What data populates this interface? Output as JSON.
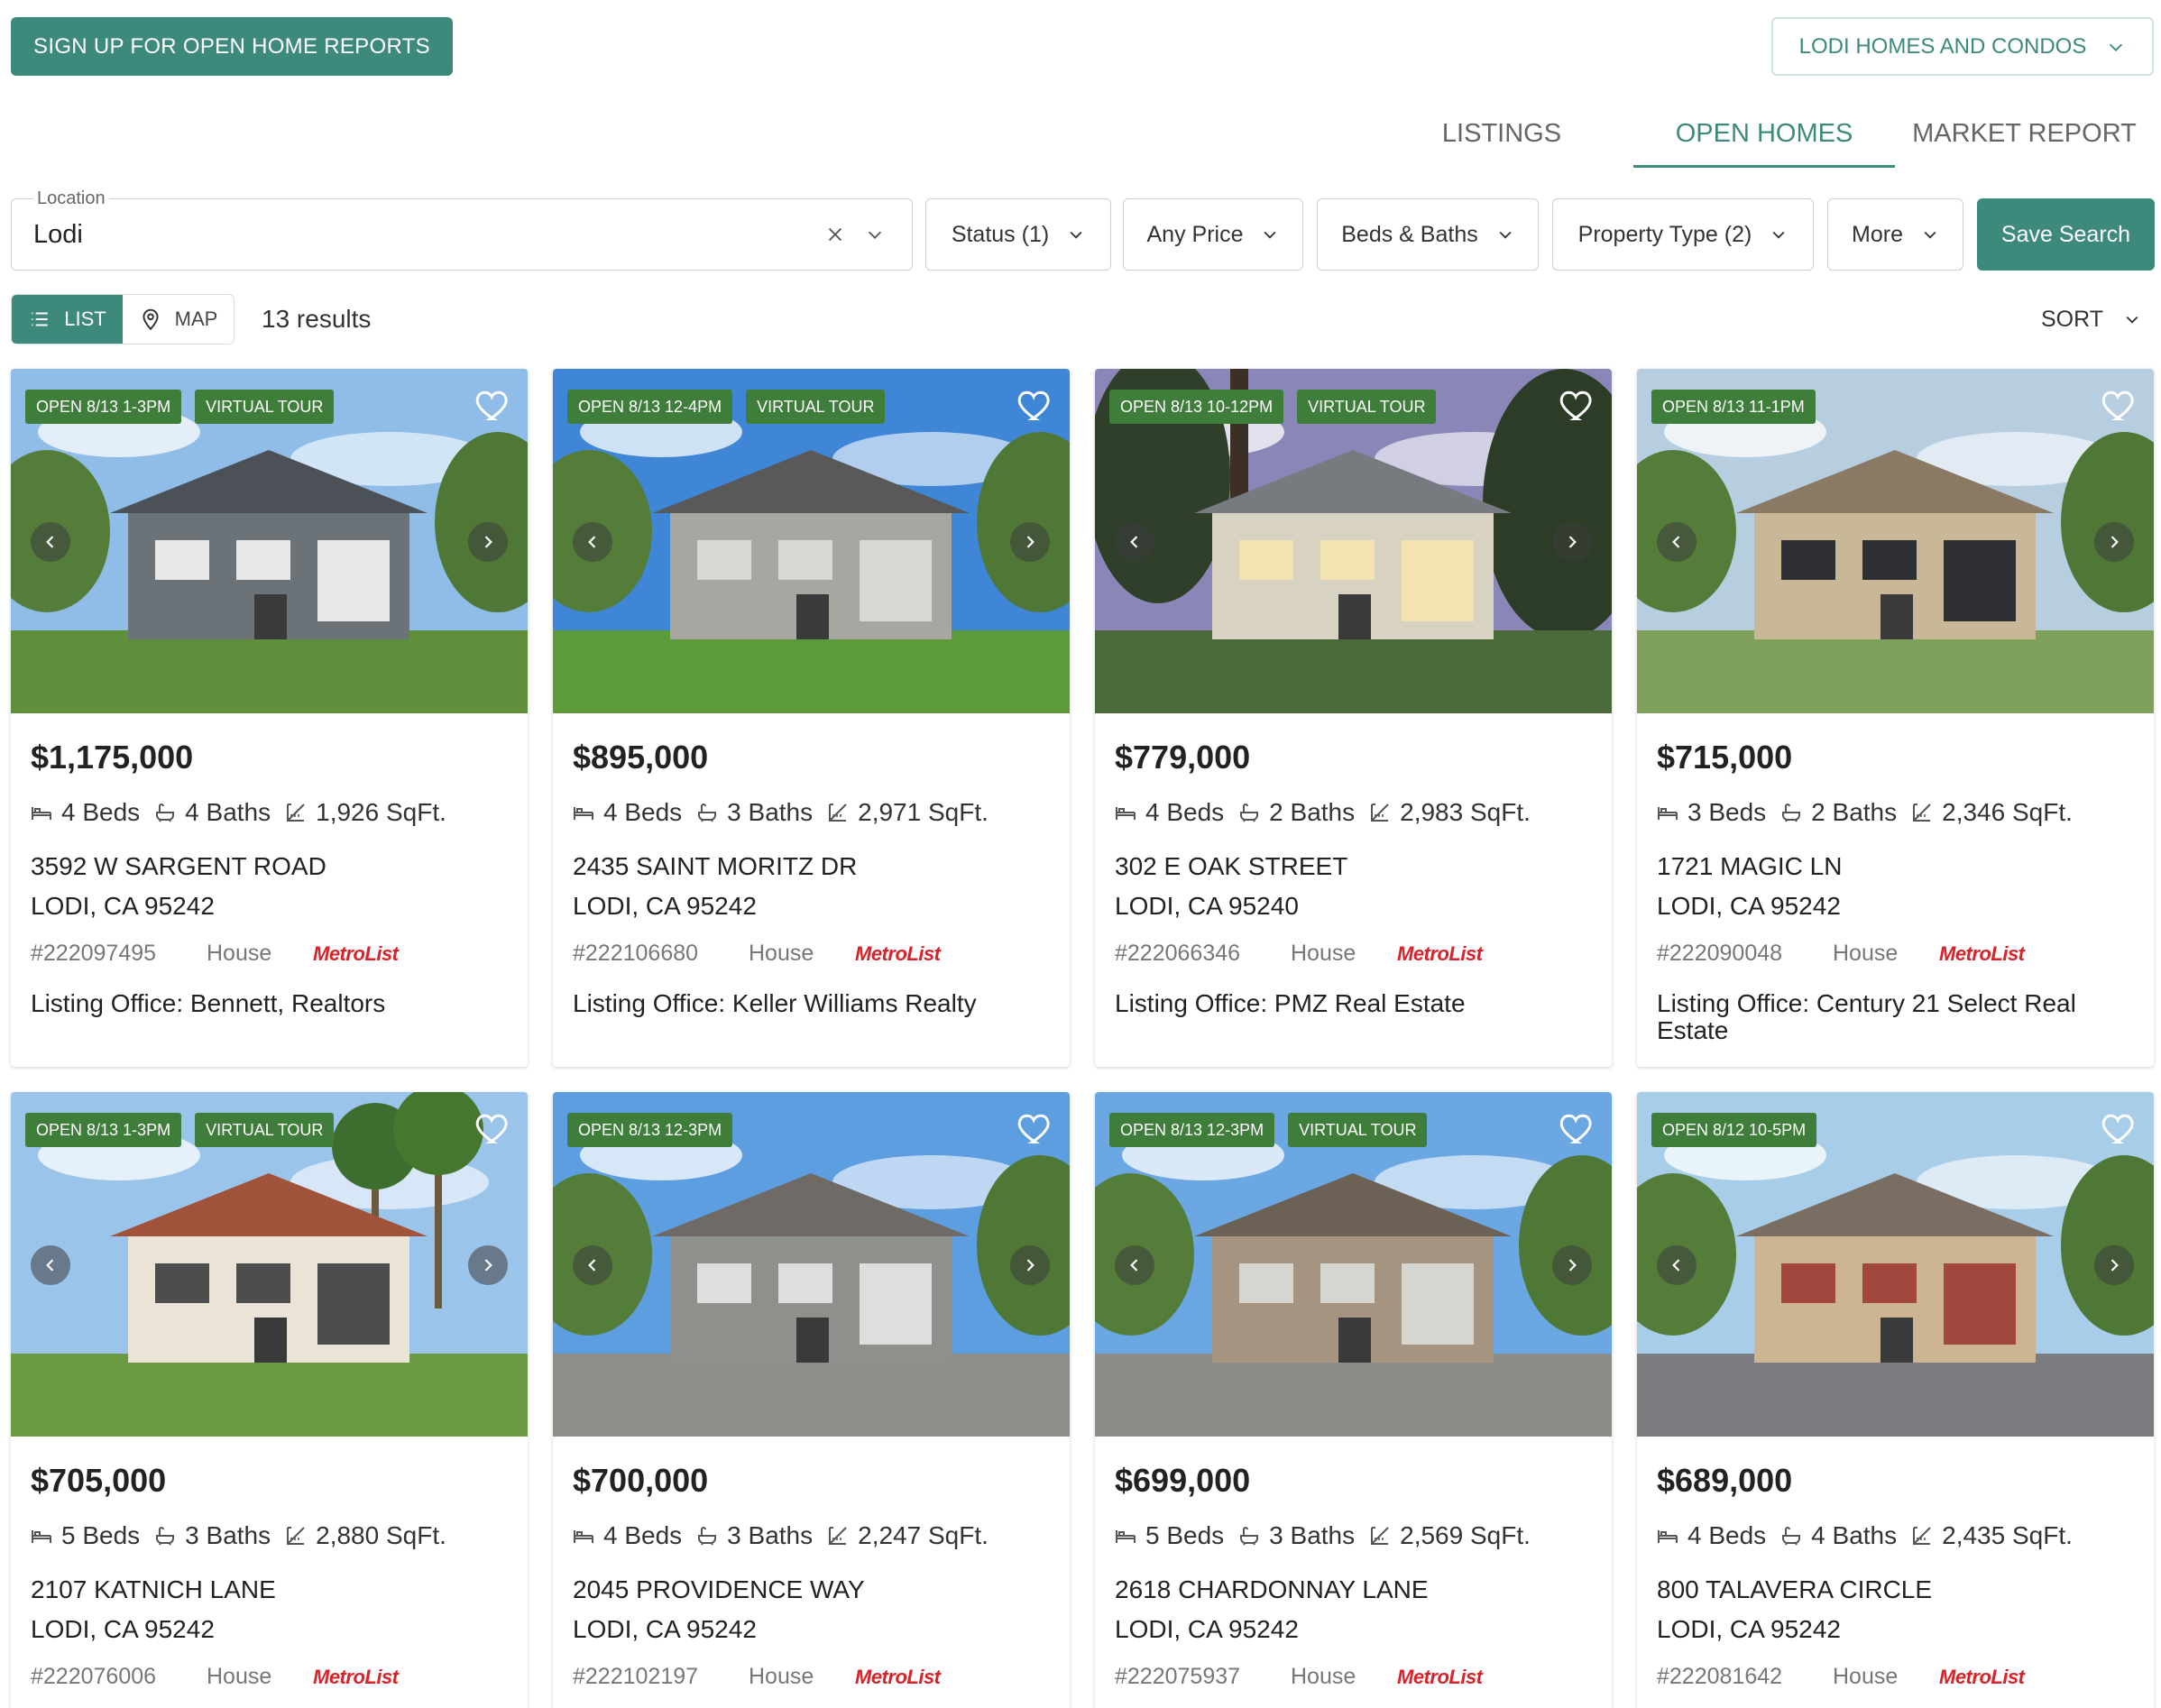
{
  "header": {
    "signup_label": "SIGN UP FOR OPEN HOME REPORTS",
    "area_label": "LODI HOMES AND CONDOS"
  },
  "tabs": [
    {
      "label": "LISTINGS"
    },
    {
      "label": "OPEN HOMES",
      "active": true
    },
    {
      "label": "MARKET REPORT"
    }
  ],
  "filters": {
    "location_label": "Location",
    "location_value": "Lodi",
    "status": "Status (1)",
    "price": "Any Price",
    "beds_baths": "Beds & Baths",
    "property_type": "Property Type (2)",
    "more": "More",
    "save": "Save Search"
  },
  "view": {
    "list_label": "LIST",
    "map_label": "MAP",
    "results": "13 results",
    "sort_label": "SORT"
  },
  "colors": {
    "accent": "#3d8a7c",
    "badge": "#3f7d3b",
    "metrolist": "#d8232a"
  },
  "listings": [
    {
      "open": "OPEN 8/13 1-3PM",
      "virtual": "VIRTUAL TOUR",
      "price": "$1,175,000",
      "beds": "4 Beds",
      "baths": "4 Baths",
      "sqft": "1,926 SqFt.",
      "street": "3592 W SARGENT ROAD",
      "city": "LODI, CA 95242",
      "mls": "#222097495",
      "type": "House",
      "source": "MetroList",
      "office": "Listing Office: Bennett, Realtors"
    },
    {
      "open": "OPEN 8/13 12-4PM",
      "virtual": "VIRTUAL TOUR",
      "price": "$895,000",
      "beds": "4 Beds",
      "baths": "3 Baths",
      "sqft": "2,971 SqFt.",
      "street": "2435 SAINT MORITZ DR",
      "city": "LODI, CA 95242",
      "mls": "#222106680",
      "type": "House",
      "source": "MetroList",
      "office": "Listing Office: Keller Williams Realty"
    },
    {
      "open": "OPEN 8/13 10-12PM",
      "virtual": "VIRTUAL TOUR",
      "price": "$779,000",
      "beds": "4 Beds",
      "baths": "2 Baths",
      "sqft": "2,983 SqFt.",
      "street": "302 E OAK STREET",
      "city": "LODI, CA 95240",
      "mls": "#222066346",
      "type": "House",
      "source": "MetroList",
      "office": "Listing Office: PMZ Real Estate"
    },
    {
      "open": "OPEN 8/13 11-1PM",
      "virtual": "",
      "price": "$715,000",
      "beds": "3 Beds",
      "baths": "2 Baths",
      "sqft": "2,346 SqFt.",
      "street": "1721 MAGIC LN",
      "city": "LODI, CA 95242",
      "mls": "#222090048",
      "type": "House",
      "source": "MetroList",
      "office": "Listing Office: Century 21 Select Real Estate"
    },
    {
      "open": "OPEN 8/13 1-3PM",
      "virtual": "VIRTUAL TOUR",
      "price": "$705,000",
      "beds": "5 Beds",
      "baths": "3 Baths",
      "sqft": "2,880 SqFt.",
      "street": "2107 KATNICH LANE",
      "city": "LODI, CA 95242",
      "mls": "#222076006",
      "type": "House",
      "source": "MetroList",
      "office": ""
    },
    {
      "open": "OPEN 8/13 12-3PM",
      "virtual": "",
      "price": "$700,000",
      "beds": "4 Beds",
      "baths": "3 Baths",
      "sqft": "2,247 SqFt.",
      "street": "2045 PROVIDENCE WAY",
      "city": "LODI, CA 95242",
      "mls": "#222102197",
      "type": "House",
      "source": "MetroList",
      "office": ""
    },
    {
      "open": "OPEN 8/13 12-3PM",
      "virtual": "VIRTUAL TOUR",
      "price": "$699,000",
      "beds": "5 Beds",
      "baths": "3 Baths",
      "sqft": "2,569 SqFt.",
      "street": "2618 CHARDONNAY LANE",
      "city": "LODI, CA 95242",
      "mls": "#222075937",
      "type": "House",
      "source": "MetroList",
      "office": ""
    },
    {
      "open": "OPEN 8/12 10-5PM",
      "virtual": "",
      "price": "$689,000",
      "beds": "4 Beds",
      "baths": "4 Baths",
      "sqft": "2,435 SqFt.",
      "street": "800 TALAVERA CIRCLE",
      "city": "LODI, CA 95242",
      "mls": "#222081642",
      "type": "House",
      "source": "MetroList",
      "office": ""
    }
  ]
}
